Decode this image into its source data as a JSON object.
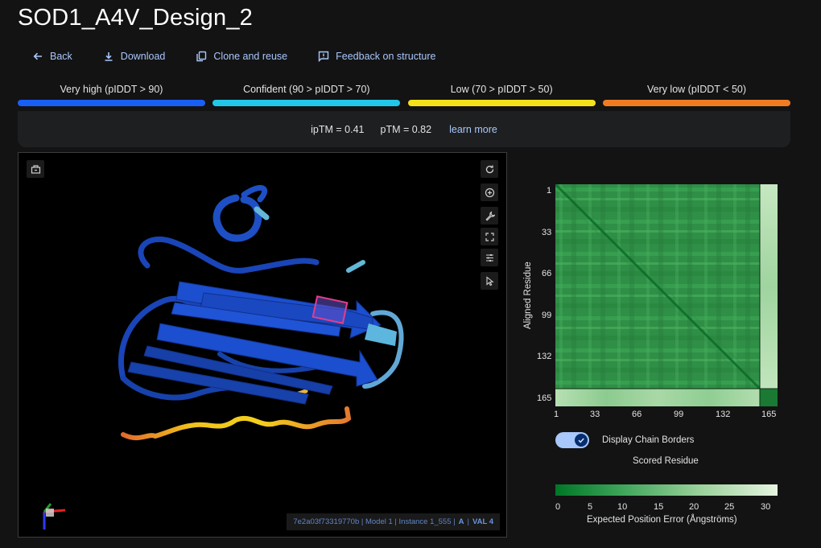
{
  "header": {
    "title": "SOD1_A4V_Design_2"
  },
  "toolbar": {
    "back": "Back",
    "download": "Download",
    "clone": "Clone and reuse",
    "feedback": "Feedback on structure"
  },
  "plddt_legend": [
    {
      "label": "Very high (pIDDT > 90)",
      "color": "#1a5ff5"
    },
    {
      "label": "Confident (90 > pIDDT > 70)",
      "color": "#22c7e8"
    },
    {
      "label": "Low (70 > pIDDT > 50)",
      "color": "#f5e11a"
    },
    {
      "label": "Very low (pIDDT < 50)",
      "color": "#f27b22"
    }
  ],
  "metrics": {
    "iptm": "ipTM = 0.41",
    "ptm": "pTM = 0.82",
    "learn_more": "learn more"
  },
  "viewer": {
    "info_prefix": "7e2a03f73319770b | Model 1 | Instance 1_555 |",
    "chain": "A",
    "sep": "|",
    "residue": "VAL 4"
  },
  "pae": {
    "y_axis_label": "Aligned Residue",
    "x_axis_label": "Scored Residue",
    "y_ticks": [
      "1",
      "33",
      "66",
      "99",
      "132",
      "165"
    ],
    "x_ticks": [
      "1",
      "33",
      "66",
      "99",
      "132",
      "165"
    ],
    "toggle_label": "Display Chain Borders",
    "toggle_on": true,
    "scale_ticks": [
      "0",
      "5",
      "10",
      "15",
      "20",
      "25",
      "30"
    ],
    "scale_title": "Expected Position Error (Ångströms)"
  }
}
